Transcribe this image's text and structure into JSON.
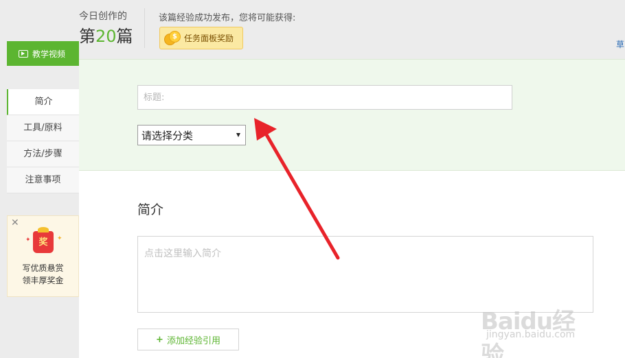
{
  "header": {
    "count_label": "今日创作的",
    "count_prefix": "第",
    "count_value": "20",
    "count_suffix": "篇",
    "publish_text": "该篇经验成功发布，您将可能获得:",
    "reward_label": "任务面板奖励",
    "coin_symbol": "$",
    "draft_link": "草"
  },
  "sidebar": {
    "video_tab": "教学视频",
    "nav_items": [
      "简介",
      "工具/原料",
      "方法/步骤",
      "注意事项"
    ],
    "active_index": 0
  },
  "promo": {
    "close": "✕",
    "badge": "奖",
    "line1": "写优质悬赏",
    "line2": "领丰厚奖金"
  },
  "editor": {
    "title_placeholder": "标题:",
    "category_selected": "请选择分类",
    "intro_heading": "简介",
    "intro_placeholder": "点击这里输入简介",
    "add_reference_plus": "+",
    "add_reference_label": "添加经验引用"
  },
  "watermark": {
    "brand": "Baidu经验",
    "url": "jingyan.baidu.com"
  },
  "colors": {
    "accent_green": "#5cb531",
    "annotation_arrow": "#e8232a"
  }
}
